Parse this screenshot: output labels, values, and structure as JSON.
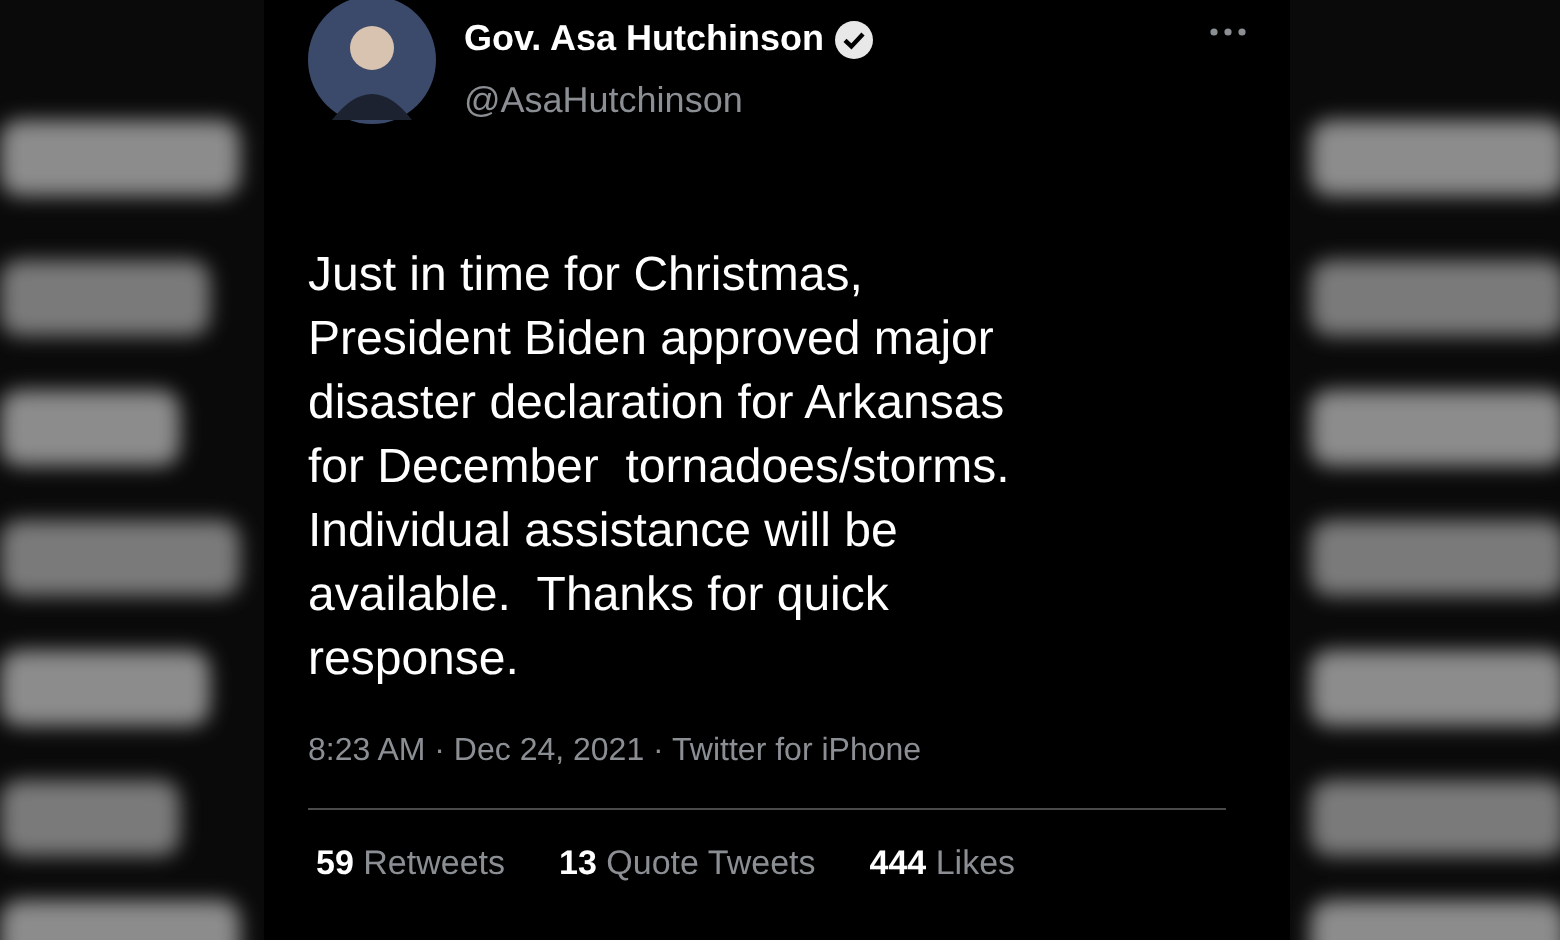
{
  "tweet": {
    "author_name": "Gov. Asa Hutchinson",
    "verified": true,
    "handle": "@AsaHutchinson",
    "text": "Just in time for Christmas,\nPresident Biden approved major\ndisaster declaration for Arkansas\nfor December  tornadoes/storms.\nIndividual assistance will be\navailable.  Thanks for quick\nresponse.",
    "meta": "8:23 AM · Dec 24, 2021 · Twitter for iPhone",
    "stats": [
      "**59** Retweets",
      "**13** Quote Tweets",
      "**444** Likes"
    ]
  }
}
